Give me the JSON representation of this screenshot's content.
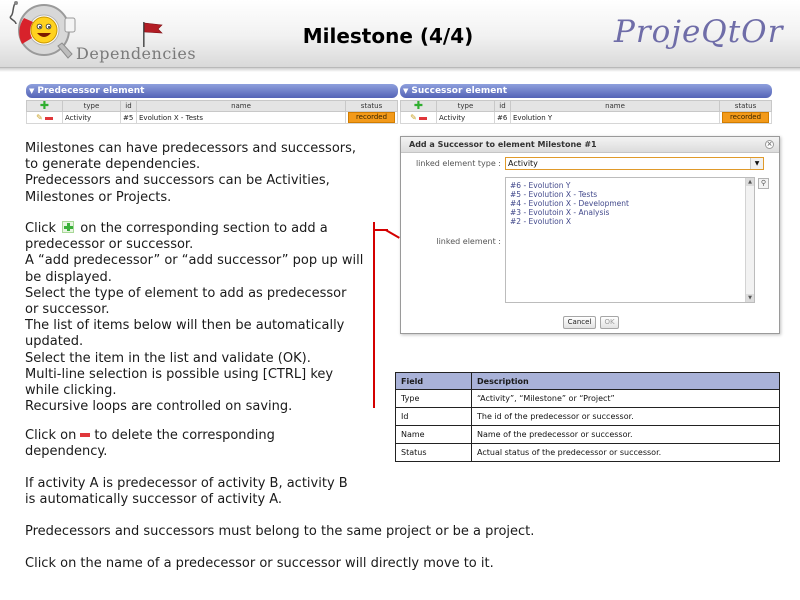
{
  "header": {
    "section_title": "Dependencies",
    "page_title": "Milestone (4/4)",
    "brand": "ProjeQtOr"
  },
  "predecessor": {
    "title": "Predecessor element",
    "columns": [
      "type",
      "id",
      "name",
      "status"
    ],
    "rows": [
      {
        "type": "Activity",
        "id": "#5",
        "name": "Evolution X - Tests",
        "status": "recorded"
      }
    ]
  },
  "successor": {
    "title": "Successor element",
    "columns": [
      "type",
      "id",
      "name",
      "status"
    ],
    "rows": [
      {
        "type": "Activity",
        "id": "#6",
        "name": "Evolution Y",
        "status": "recorded"
      }
    ]
  },
  "text": {
    "intro": [
      "Milestones can have predecessors and successors,",
      "to generate dependencies.",
      "Predecessors and successors can be Activities,",
      "Milestones or Projects."
    ],
    "click_pre": "Click",
    "click_post": "on the corresponding section to add a",
    "steps": [
      "predecessor or successor.",
      "A “add predecessor” or “add successor” pop up will",
      "be displayed.",
      "Select the type of element to add as predecessor",
      "or successor.",
      "The list of items below will then be automatically",
      "updated.",
      "Select the item in the list and validate (OK).",
      "Multi-line selection is possible using [CTRL] key",
      "while clicking.",
      "Recursive loops are controlled on saving."
    ],
    "delete_pre": "Click on",
    "delete_post": "to delete the corresponding",
    "delete_line2": "dependency.",
    "rule_lines": [
      "If activity A is predecessor of activity B, activity B",
      "is automatically successor of activity A."
    ],
    "belong": "Predecessors and successors must belong to the same project or be a project.",
    "move": "Click on the name of a predecessor or successor will directly move to it."
  },
  "dialog": {
    "title": "Add a Successor to element Milestone #1",
    "type_label": "linked element type :",
    "type_value": "Activity",
    "element_label": "linked element :",
    "items": [
      "#6 - Evolution Y",
      "#5 - Evolution X - Tests",
      "#4 - Evolution X - Development",
      "#3 - Evolutoin X - Analysis",
      "#2 - Evolution X"
    ],
    "cancel_label": "Cancel",
    "ok_label": "OK"
  },
  "fields_table": {
    "headers": [
      "Field",
      "Description"
    ],
    "rows": [
      {
        "field": "Type",
        "desc": "“Activity”, “Milestone” or “Project”"
      },
      {
        "field": "Id",
        "desc": "The id of the predecessor or successor."
      },
      {
        "field": "Name",
        "desc": "Name of the predecessor or successor."
      },
      {
        "field": "Status",
        "desc": "Actual status of the predecessor or successor."
      }
    ]
  },
  "colors": {
    "section_bar": "#5463b6",
    "status_recorded": "#f39a1a",
    "connector": "#d40000",
    "table_header": "#a9b2d8",
    "brand": "#6f6da8"
  },
  "icons": [
    "logo-icon",
    "flag-icon",
    "add-icon",
    "edit-icon",
    "delete-icon",
    "close-icon",
    "search-icon",
    "chevron-down-icon"
  ]
}
